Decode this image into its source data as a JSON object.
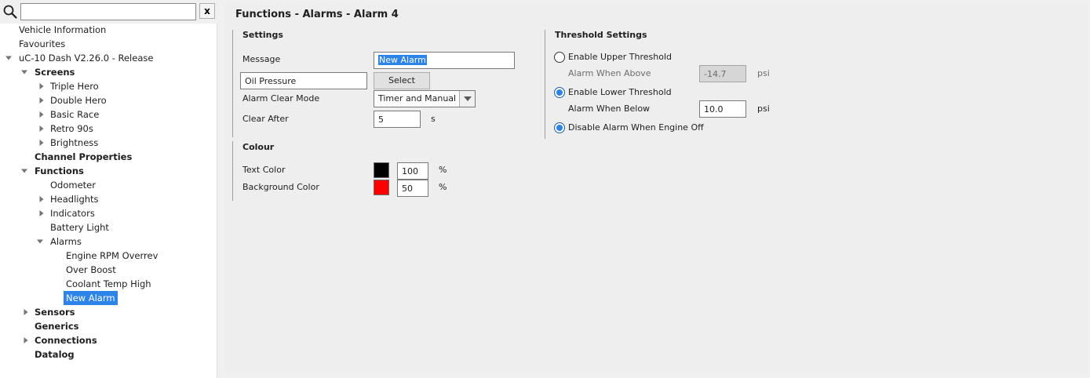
{
  "search": {
    "value": "",
    "clear_label": "x"
  },
  "tree": {
    "vehicle_information": "Vehicle Information",
    "favourites": "Favourites",
    "project": "uC-10 Dash V2.26.0 - Release",
    "screens": "Screens",
    "triple_hero": "Triple Hero",
    "double_hero": "Double Hero",
    "basic_race": "Basic Race",
    "retro_90s": "Retro 90s",
    "brightness": "Brightness",
    "channel_properties": "Channel Properties",
    "functions": "Functions",
    "odometer": "Odometer",
    "headlights": "Headlights",
    "indicators": "Indicators",
    "battery_light": "Battery Light",
    "alarms": "Alarms",
    "engine_rpm_overrev": "Engine RPM Overrev",
    "over_boost": "Over Boost",
    "coolant_temp_high": "Coolant Temp High",
    "new_alarm": "New Alarm",
    "sensors": "Sensors",
    "generics": "Generics",
    "connections": "Connections",
    "datalog": "Datalog"
  },
  "page": {
    "title": "Functions - Alarms - Alarm 4"
  },
  "settings": {
    "title": "Settings",
    "message_label": "Message",
    "message_value": "New Alarm",
    "channel_value": "Oil Pressure",
    "select_label": "Select",
    "clear_mode_label": "Alarm Clear Mode",
    "clear_mode_value": "Timer and Manual",
    "clear_after_label": "Clear After",
    "clear_after_value": "5",
    "clear_after_unit": "s"
  },
  "colour": {
    "title": "Colour",
    "text_color_label": "Text Color",
    "text_color": "#000000",
    "text_opacity": "100",
    "text_opacity_unit": "%",
    "bg_color_label": "Background Color",
    "bg_color": "#ff0000",
    "bg_opacity": "50",
    "bg_opacity_unit": "%"
  },
  "threshold": {
    "title": "Threshold Settings",
    "enable_upper_label": "Enable Upper Threshold",
    "enable_upper_checked": false,
    "when_above_label": "Alarm When Above",
    "when_above_value": "-14.7",
    "when_above_unit": "psi",
    "enable_lower_label": "Enable Lower Threshold",
    "enable_lower_checked": true,
    "when_below_label": "Alarm When Below",
    "when_below_value": "10.0",
    "when_below_unit": "psi",
    "disable_engine_off_label": "Disable Alarm When Engine Off",
    "disable_engine_off_checked": true
  }
}
